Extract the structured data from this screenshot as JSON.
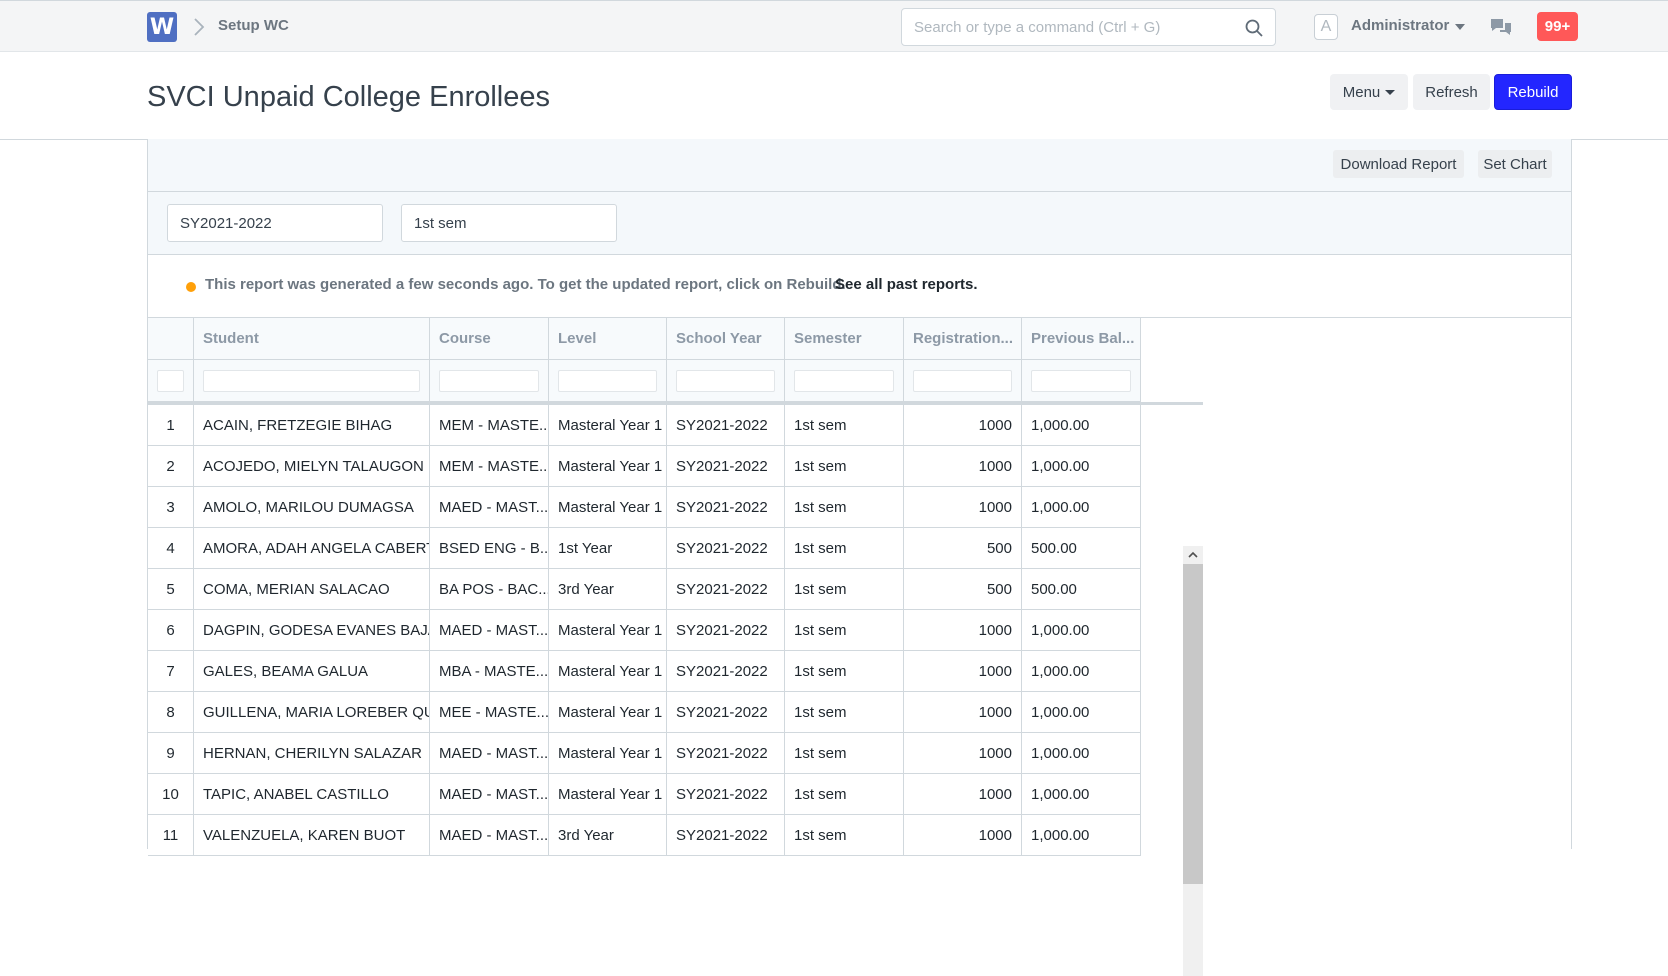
{
  "navbar": {
    "logo": "W",
    "breadcrumb": "Setup WC",
    "search_placeholder": "Search or type a command (Ctrl + G)",
    "avatar_letter": "A",
    "user": "Administrator",
    "notifications": "99+"
  },
  "page": {
    "title": "SVCI Unpaid College Enrollees",
    "menu_label": "Menu",
    "refresh_label": "Refresh",
    "rebuild_label": "Rebuild"
  },
  "toolbar": {
    "download_label": "Download Report",
    "set_chart_label": "Set Chart"
  },
  "filters": {
    "school_year": "SY2021-2022",
    "semester": "1st sem"
  },
  "notice": {
    "text": "This report was generated a few seconds ago. To get the updated report, click on Rebuild.",
    "link": "See all past reports."
  },
  "table": {
    "columns": [
      "Student",
      "Course",
      "Level",
      "School Year",
      "Semester",
      "Registration...",
      "Previous Bal..."
    ],
    "rows": [
      [
        "1",
        "ACAIN, FRETZEGIE BIHAG",
        "MEM - MASTE...",
        "Masteral Year 1",
        "SY2021-2022",
        "1st sem",
        "1000",
        "1,000.00"
      ],
      [
        "2",
        "ACOJEDO, MIELYN TALAUGON",
        "MEM - MASTE...",
        "Masteral Year 1",
        "SY2021-2022",
        "1st sem",
        "1000",
        "1,000.00"
      ],
      [
        "3",
        "AMOLO, MARILOU DUMAGSA",
        "MAED - MAST...",
        "Masteral Year 1",
        "SY2021-2022",
        "1st sem",
        "1000",
        "1,000.00"
      ],
      [
        "4",
        "AMORA, ADAH ANGELA CABERTE",
        "BSED ENG - B...",
        "1st Year",
        "SY2021-2022",
        "1st sem",
        "500",
        "500.00"
      ],
      [
        "5",
        "COMA, MERIAN SALACAO",
        "BA POS - BAC...",
        "3rd Year",
        "SY2021-2022",
        "1st sem",
        "500",
        "500.00"
      ],
      [
        "6",
        "DAGPIN, GODESA EVANES BAJAO",
        "MAED - MAST...",
        "Masteral Year 1",
        "SY2021-2022",
        "1st sem",
        "1000",
        "1,000.00"
      ],
      [
        "7",
        "GALES, BEAMA GALUA",
        "MBA - MASTE...",
        "Masteral Year 1",
        "SY2021-2022",
        "1st sem",
        "1000",
        "1,000.00"
      ],
      [
        "8",
        "GUILLENA, MARIA LOREBER QUIS...",
        "MEE - MASTE...",
        "Masteral Year 1",
        "SY2021-2022",
        "1st sem",
        "1000",
        "1,000.00"
      ],
      [
        "9",
        "HERNAN, CHERILYN SALAZAR",
        "MAED - MAST...",
        "Masteral Year 1",
        "SY2021-2022",
        "1st sem",
        "1000",
        "1,000.00"
      ],
      [
        "10",
        "TAPIC, ANABEL CASTILLO",
        "MAED - MAST...",
        "Masteral Year 1",
        "SY2021-2022",
        "1st sem",
        "1000",
        "1,000.00"
      ],
      [
        "11",
        "VALENZUELA, KAREN BUOT",
        "MAED - MAST...",
        "3rd Year",
        "SY2021-2022",
        "1st sem",
        "1000",
        "1,000.00"
      ]
    ]
  },
  "colors": {
    "primary": "#2326ff",
    "notification": "#ff5858",
    "notice_dot": "#ffa00a"
  }
}
